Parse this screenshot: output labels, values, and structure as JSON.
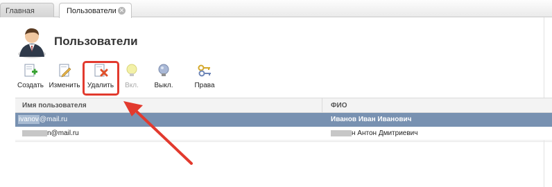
{
  "tabs": [
    {
      "label": "Главная"
    },
    {
      "label": "Пользователи",
      "close_glyph": "✕"
    }
  ],
  "page": {
    "title": "Пользователи",
    "icon": "user-avatar-icon"
  },
  "toolbar": [
    {
      "label": "Создать",
      "icon": "create-user-icon",
      "enabled": true
    },
    {
      "label": "Изменить",
      "icon": "edit-icon",
      "enabled": true
    },
    {
      "label": "Удалить",
      "icon": "delete-icon",
      "enabled": true,
      "highlighted": true
    },
    {
      "label": "Вкл.",
      "icon": "bulb-on-icon",
      "enabled": false
    },
    {
      "label": "Выкл.",
      "icon": "bulb-off-icon",
      "enabled": true
    },
    {
      "label": "Права",
      "icon": "keys-icon",
      "enabled": true
    }
  ],
  "grid": {
    "columns": [
      "Имя пользователя",
      "ФИО"
    ],
    "rows": [
      {
        "username_selected_part": "ivanov",
        "username_rest": "@mail.ru",
        "fio": "Иванов Иван Иванович",
        "selected": true
      },
      {
        "username_hidden": "██████",
        "username_rest": "n@mail.ru",
        "fio_hidden": "████",
        "fio": "н Антон Дмитриевич",
        "selected": false
      }
    ]
  },
  "colors": {
    "selection": "#7891b1",
    "annotation": "#e23a2e"
  }
}
